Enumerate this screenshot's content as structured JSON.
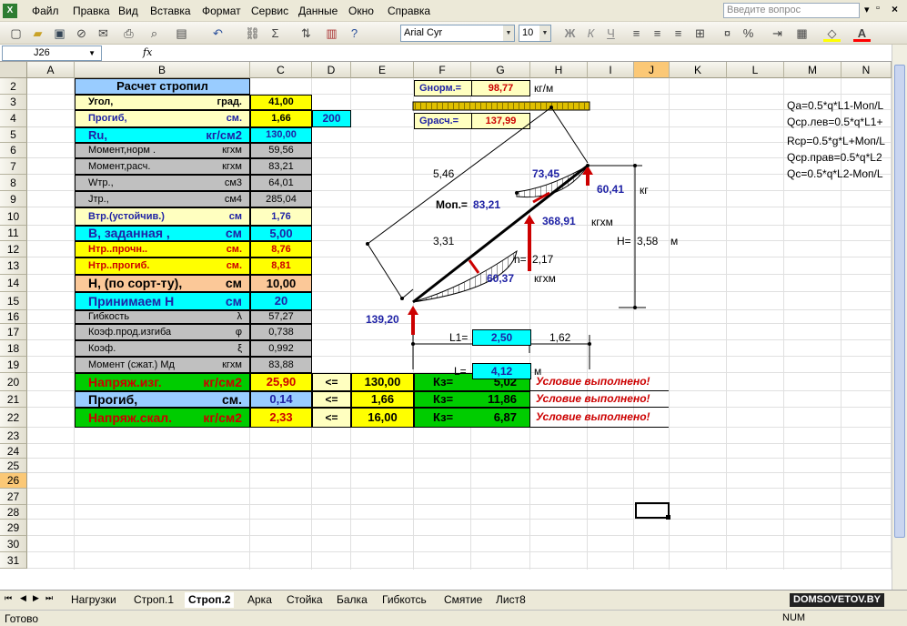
{
  "menu": [
    "Файл",
    "Правка",
    "Вид",
    "Вставка",
    "Формат",
    "Сервис",
    "Данные",
    "Окно",
    "Справка"
  ],
  "help_placeholder": "Введите вопрос",
  "toolbar": {
    "font": "Arial Cyr",
    "size": "10"
  },
  "namebox": "J26",
  "fx": "fx",
  "columns": [
    "A",
    "B",
    "C",
    "D",
    "E",
    "F",
    "G",
    "H",
    "I",
    "J",
    "K",
    "L",
    "M",
    "N"
  ],
  "rows": [
    "2",
    "3",
    "4",
    "5",
    "6",
    "7",
    "8",
    "9",
    "10",
    "11",
    "12",
    "13",
    "14",
    "15",
    "16",
    "17",
    "18",
    "19",
    "20",
    "21",
    "22",
    "23",
    "24",
    "25",
    "26",
    "27",
    "28",
    "29",
    "30",
    "31"
  ],
  "table": {
    "title": "Расчет стропил",
    "r3": {
      "a": "Угол,",
      "b": "град.",
      "v": "41,00"
    },
    "r4": {
      "a": "Прогиб,",
      "b": "см.",
      "v": "1,66",
      "d": "200"
    },
    "r5": {
      "a": "Ru,",
      "b": "кг/см2",
      "v": "130,00"
    },
    "r6": {
      "a": "Момент,норм  .",
      "b": "кгхм",
      "v": "59,56"
    },
    "r7": {
      "a": "Момент,расч.",
      "b": "кгхм",
      "v": "83,21"
    },
    "r8": {
      "a": "Wтр.,",
      "b": "см3",
      "v": "64,01"
    },
    "r9": {
      "a": "Jтр.,",
      "b": "см4",
      "v": "285,04"
    },
    "r10": {
      "a": "Втр.(устойчив.)",
      "b": "см",
      "v": "1,76"
    },
    "r11": {
      "a": "В, заданная ,",
      "b": "см",
      "v": "5,00"
    },
    "r12": {
      "a": "Нтр..прочн..",
      "b": "см.",
      "v": "8,76"
    },
    "r13": {
      "a": "Нтр..прогиб.",
      "b": "см.",
      "v": "8,81"
    },
    "r14": {
      "a": "Н, (по сорт-ту),",
      "b": "см",
      "v": "10,00"
    },
    "r15": {
      "a": "Принимаем Н",
      "b": "см",
      "v": "20"
    },
    "r16": {
      "a": "Гибкость",
      "b": "λ",
      "v": "57,27"
    },
    "r17": {
      "a": "Коэф.прод.изгиба",
      "b": "φ",
      "v": "0,738"
    },
    "r18": {
      "a": "Коэф.",
      "b": "ξ",
      "v": "0,992"
    },
    "r19": {
      "a": "Момент (сжат.)  Мд",
      "b": "кгхм",
      "v": "83,88"
    },
    "r20": {
      "a": "Напряж.изг.",
      "b": "кг/см2",
      "v": "25,90",
      "op": "<=",
      "lim": "130,00",
      "k": "Кз=",
      "kv": "5,02",
      "msg": "Условие выполнено!"
    },
    "r21": {
      "a": "Прогиб,",
      "b": "см.",
      "v": "0,14",
      "op": "<=",
      "lim": "1,66",
      "k": "Кз=",
      "kv": "11,86",
      "msg": "Условие выполнено!"
    },
    "r22": {
      "a": "Напряж.скал.",
      "b": "кг/см2",
      "v": "2,33",
      "op": "<=",
      "lim": "16,00",
      "k": "Кз=",
      "kv": "6,87",
      "msg": "Условие выполнено!"
    }
  },
  "loads": {
    "gnorm_label": "Gнорм.=",
    "gnorm": "98,77",
    "unit": "кг/м",
    "grasch_label": "Gрасч.=",
    "grasch": "137,99"
  },
  "diagram": {
    "l546": "5,46",
    "l7345": "73,45",
    "l6041": "60,41",
    "kg": "кг",
    "mon": "Моп.=",
    "mon_v": "83,21",
    "m36891": "368,91",
    "kgxm": "кгхм",
    "l331": "3,31",
    "h": "h=",
    "h_v": "2,17",
    "kgxm2": "кгхм",
    "l6037": "60,37",
    "H": "H=",
    "H_v": "3,58",
    "m": "м",
    "r13920": "139,20",
    "L1": "L1=",
    "L1_v": "2,50",
    "l162": "1,62",
    "L": "L=",
    "L_v": "4,12",
    "m2": "м"
  },
  "formulas": [
    "Qa=0.5*q*L1-Mоп/L",
    "Qср.лев=0.5*q*L1+",
    "Rср=0.5*g*L+Mоп/L",
    "Qср.прав=0.5*q*L2",
    "Qc=0.5*q*L2-Mоп/L"
  ],
  "sheets": [
    "Нагрузки",
    "Строп.1",
    "Строп.2",
    "Арка",
    "Стойка",
    "Балка",
    "Гибкотсь",
    "Смятие",
    "Лист8"
  ],
  "watermark": "DOMSOVETOV.BY",
  "status": {
    "left": "Готово",
    "num": "NUM"
  },
  "colors": {
    "cyan": "#00ffff",
    "yellow": "#ffff00",
    "lightblue": "#99ccff",
    "green": "#00cc00",
    "peach": "#fbc898",
    "gray": "#c0c0c0",
    "red": "#cc0000"
  }
}
